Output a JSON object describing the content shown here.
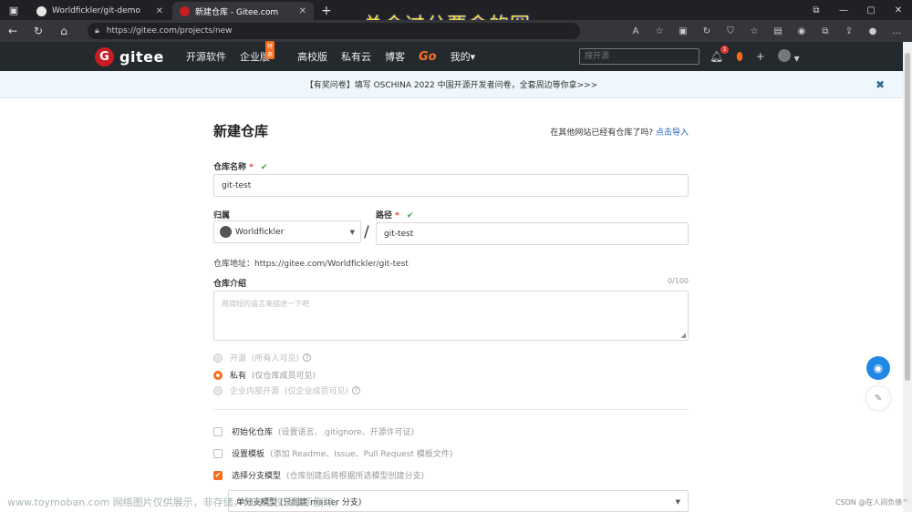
{
  "browser": {
    "tabs": [
      {
        "title": "Worldfickler/git-demo",
        "favicon_color": "#e6e6e6"
      },
      {
        "title": "新建仓库 - Gitee.com",
        "favicon_color": "#c71d23"
      }
    ],
    "url": "https://gitee.com/projects/new",
    "overlay_caption": "总会过分要命的囧"
  },
  "header": {
    "logo_text": "gitee",
    "logo_letter": "G",
    "menu": [
      "开源软件",
      "企业版",
      "高校版",
      "私有云",
      "博客",
      "Go",
      "我的▾"
    ],
    "enterprise_badge": "特惠",
    "search_placeholder": "搜开源",
    "notification_count": "1"
  },
  "notice": {
    "text": "【有奖问卷】填写 OSCHINA 2022 中国开源开发者问卷，全套周边等你拿>>>"
  },
  "form": {
    "title": "新建仓库",
    "import_text": "在其他网站已经有仓库了吗?",
    "import_link": "点击导入",
    "name_label": "仓库名称",
    "name_value": "git-test",
    "owner_label": "归属",
    "owner_value": "Worldfickler",
    "path_label": "路径",
    "path_value": "git-test",
    "slash": "/",
    "repo_address": "仓库地址：https://gitee.com/Worldfickler/git-test",
    "desc_label": "仓库介绍",
    "desc_counter": "0/100",
    "desc_placeholder": "用简短的语言来描述一下吧",
    "visibility": [
      {
        "label": "开源",
        "hint": "(所有人可见)",
        "selected": false,
        "disabled": true
      },
      {
        "label": "私有",
        "hint": "(仅仓库成员可见)",
        "selected": true,
        "disabled": false
      },
      {
        "label": "企业内部开源",
        "hint": "(仅企业成员可见)",
        "selected": false,
        "disabled": true
      }
    ],
    "options": [
      {
        "label": "初始化仓库",
        "hint": "(设置语言、.gitignore、开源许可证)",
        "checked": false
      },
      {
        "label": "设置模板",
        "hint": "(添加 Readme、Issue、Pull Request 模板文件)",
        "checked": false
      },
      {
        "label": "选择分支模型",
        "hint": "(仓库创建后将根据所选模型创建分支)",
        "checked": true
      }
    ],
    "branch_model": "单分支模型 (只创建 master 分支)"
  },
  "watermarks": {
    "left": "www.toymoban.com 网络图片仅供展示，非存储，如有侵权请联系删除。",
    "right": "CSDN @在人间负债^"
  }
}
